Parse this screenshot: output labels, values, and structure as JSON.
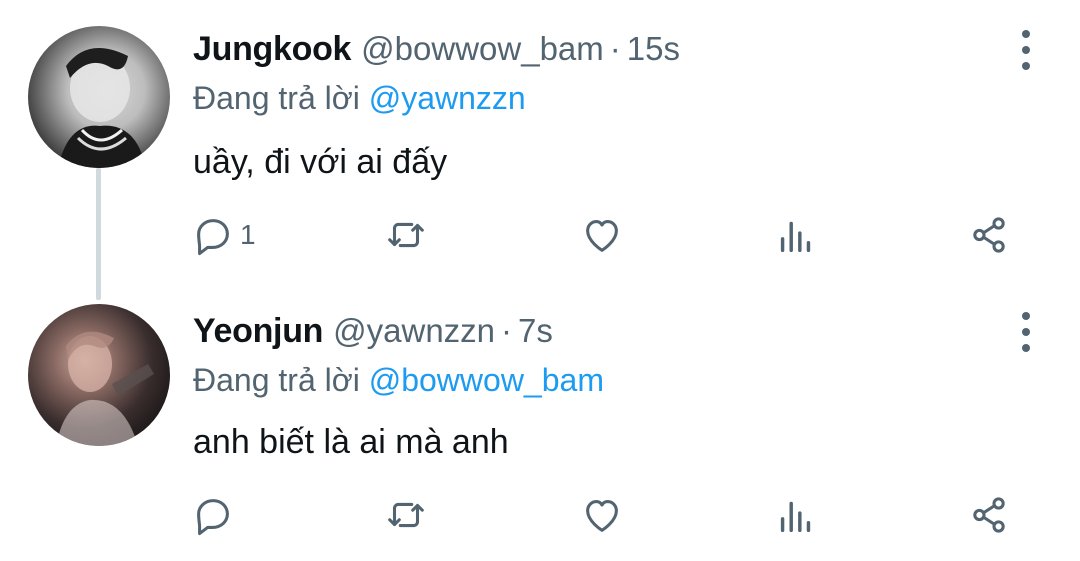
{
  "tweets": [
    {
      "display_name": "Jungkook",
      "handle": "@bowwow_bam",
      "separator": "·",
      "time": "15s",
      "reply_prefix": "Đang trả lời",
      "reply_to": "@yawnzzn",
      "text": "uầy, đi với ai đấy",
      "reply_count": "1"
    },
    {
      "display_name": "Yeonjun",
      "handle": "@yawnzzn",
      "separator": "·",
      "time": "7s",
      "reply_prefix": "Đang trả lời",
      "reply_to": "@bowwow_bam",
      "text": "anh biết là ai mà anh",
      "reply_count": ""
    }
  ],
  "icons": {
    "reply": "reply-icon",
    "retweet": "retweet-icon",
    "like": "heart-icon",
    "views": "views-icon",
    "share": "share-icon",
    "more": "more-vertical-icon"
  },
  "colors": {
    "text": "#0f1419",
    "secondary": "#536471",
    "mention": "#1d9bf0",
    "thread_line": "#cfd9de",
    "background": "#ffffff"
  }
}
